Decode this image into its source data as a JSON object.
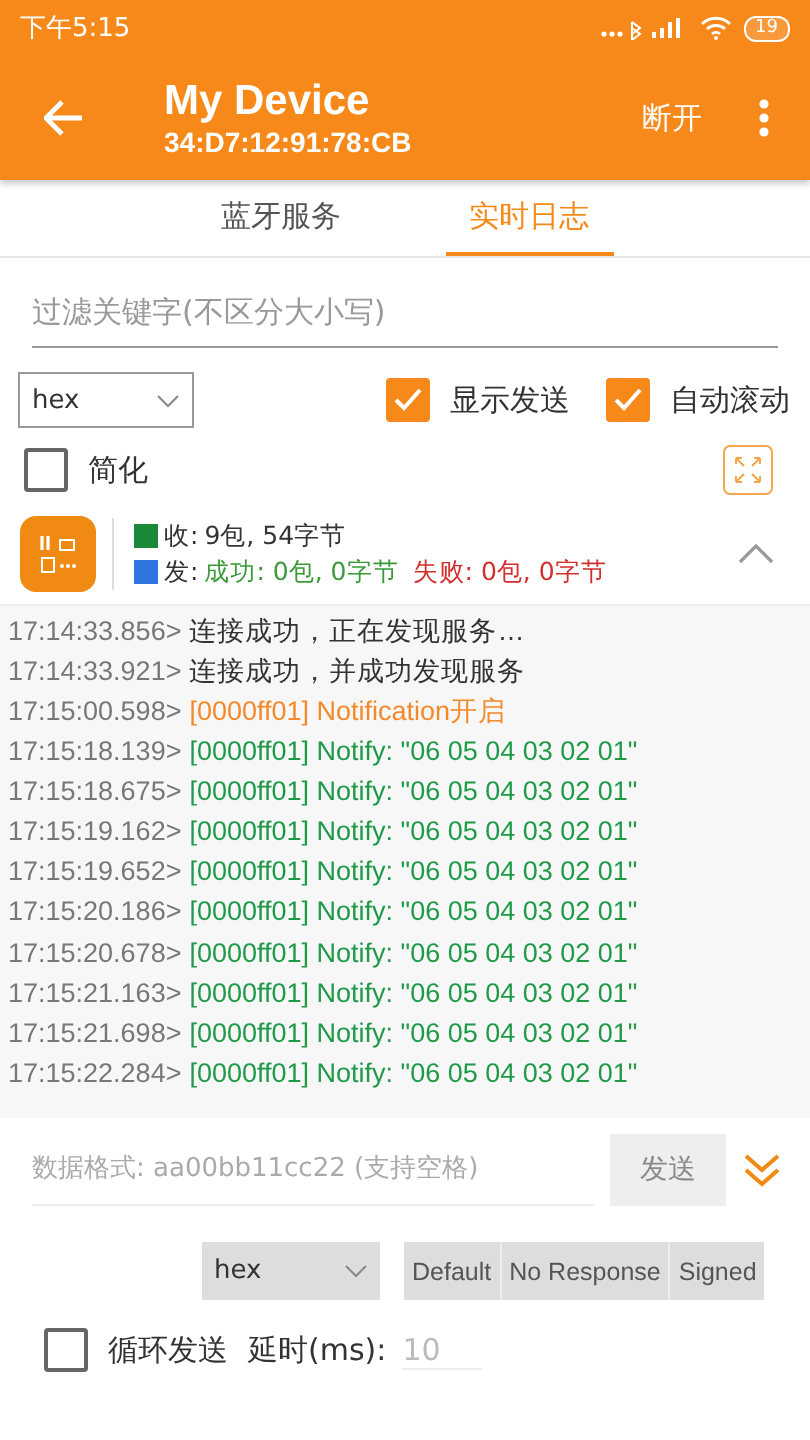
{
  "status_bar": {
    "time": "下午5:15",
    "battery": "19"
  },
  "app_bar": {
    "title": "My Device",
    "subtitle": "34:D7:12:91:78:CB",
    "action": "断开"
  },
  "tabs": [
    {
      "label": "蓝牙服务",
      "selected": false
    },
    {
      "label": "实时日志",
      "selected": true
    }
  ],
  "filter": {
    "placeholder": "过滤关键字(不区分大小写)"
  },
  "format_select": {
    "value": "hex"
  },
  "options": [
    {
      "label": "显示发送",
      "checked": true
    },
    {
      "label": "自动滚动",
      "checked": true
    }
  ],
  "simplify": {
    "label": "简化",
    "checked": false
  },
  "stats": {
    "received": {
      "color": "#1a8a3a",
      "label": "收:",
      "value": "9包, 54字节"
    },
    "sent": {
      "color": "#2f74e0",
      "label": "发:",
      "success": "成功: 0包, 0字节",
      "failure": "失败: 0包, 0字节"
    }
  },
  "log": [
    {
      "time": "17:14:33.856>",
      "message": "连接成功，正在发现服务…",
      "color": "#333333"
    },
    {
      "time": "17:14:33.921>",
      "message": "连接成功，并成功发现服务",
      "color": "#333333"
    },
    {
      "time": "17:15:00.598>",
      "message": "[0000ff01] Notification开启",
      "color": "#f5892a"
    },
    {
      "time": "17:15:18.139>",
      "message": "[0000ff01] Notify: \"06 05 04 03 02 01\"",
      "color": "#1f9a48"
    },
    {
      "time": "17:15:18.675>",
      "message": "[0000ff01] Notify: \"06 05 04 03 02 01\"",
      "color": "#1f9a48"
    },
    {
      "time": "17:15:19.162>",
      "message": "[0000ff01] Notify: \"06 05 04 03 02 01\"",
      "color": "#1f9a48"
    },
    {
      "time": "17:15:19.652>",
      "message": "[0000ff01] Notify: \"06 05 04 03 02 01\"",
      "color": "#1f9a48"
    },
    {
      "time": "17:15:20.186>",
      "message": "[0000ff01] Notify: \"06 05 04 03 02 01\"",
      "color": "#1f9a48"
    },
    {
      "time": "17:15:20.678>",
      "message": "[0000ff01] Notify: \"06 05 04 03 02 01\"",
      "color": "#1f9a48"
    },
    {
      "time": "17:15:21.163>",
      "message": "[0000ff01] Notify: \"06 05 04 03 02 01\"",
      "color": "#1f9a48"
    },
    {
      "time": "17:15:21.698>",
      "message": "[0000ff01] Notify: \"06 05 04 03 02 01\"",
      "color": "#1f9a48"
    },
    {
      "time": "17:15:22.284>",
      "message": "[0000ff01] Notify: \"06 05 04 03 02 01\"",
      "color": "#1f9a48"
    }
  ],
  "send": {
    "placeholder": "数据格式: aa00bb11cc22 (支持空格)",
    "button": "发送",
    "disabled": true
  },
  "send_format": {
    "value": "hex"
  },
  "write_types": [
    "Default",
    "No Response",
    "Signed"
  ],
  "loop": {
    "label": "循环发送",
    "checked": false,
    "delay_label": "延时(ms):",
    "delay_value": "10"
  }
}
